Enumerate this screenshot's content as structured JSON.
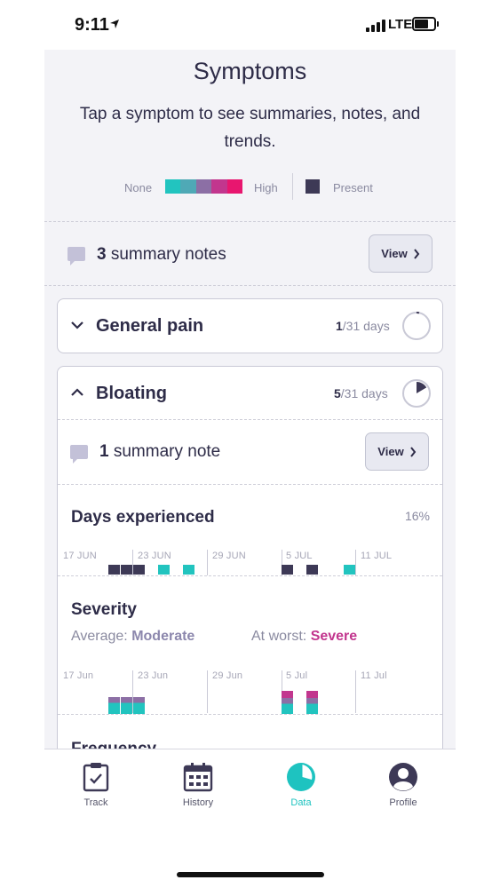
{
  "status_bar": {
    "time": "9:11",
    "network": "LTE"
  },
  "header": {
    "title": "Symptoms",
    "subtitle": "Tap a symptom to see summaries, notes, and trends."
  },
  "legend": {
    "none_label": "None",
    "high_label": "High",
    "present_label": "Present",
    "gradient_colors": [
      "#22c4bf",
      "#4fa9b6",
      "#8c6fa5",
      "#c2368e",
      "#e8166f"
    ],
    "present_color": "#3d3956"
  },
  "summary_notes": {
    "count": "3",
    "label": "summary notes",
    "view_label": "View"
  },
  "symptoms": [
    {
      "name": "General pain",
      "count": "1",
      "total": "/31 days",
      "expanded": false,
      "fraction": 0.032
    },
    {
      "name": "Bloating",
      "count": "5",
      "total": "/31 days",
      "expanded": true,
      "fraction": 0.16
    }
  ],
  "bloating_notes": {
    "count": "1",
    "label": "summary note",
    "view_label": "View"
  },
  "days_experienced": {
    "title": "Days experienced",
    "percent": "16%",
    "axis_labels": [
      "17 JUN",
      "23 JUN",
      "29 JUN",
      "5 JUL",
      "11 JUL"
    ]
  },
  "severity": {
    "title": "Severity",
    "average_label": "Average:",
    "average_value": "Moderate",
    "worst_label": "At worst:",
    "worst_value": "Severe",
    "axis_labels": [
      "17 Jun",
      "23 Jun",
      "29 Jun",
      "5 Jul",
      "11 Jul"
    ]
  },
  "next_section": {
    "title": "Frequency"
  },
  "tabs": [
    {
      "label": "Track",
      "icon": "clipboard-check-icon",
      "active": false
    },
    {
      "label": "History",
      "icon": "calendar-icon",
      "active": false
    },
    {
      "label": "Data",
      "icon": "pie-chart-icon",
      "active": true
    },
    {
      "label": "Profile",
      "icon": "user-icon",
      "active": false
    }
  ],
  "colors": {
    "teal": "#22c4bf",
    "navy": "#3d3956",
    "magenta": "#c2368e",
    "accent": "#1ec3c0"
  }
}
